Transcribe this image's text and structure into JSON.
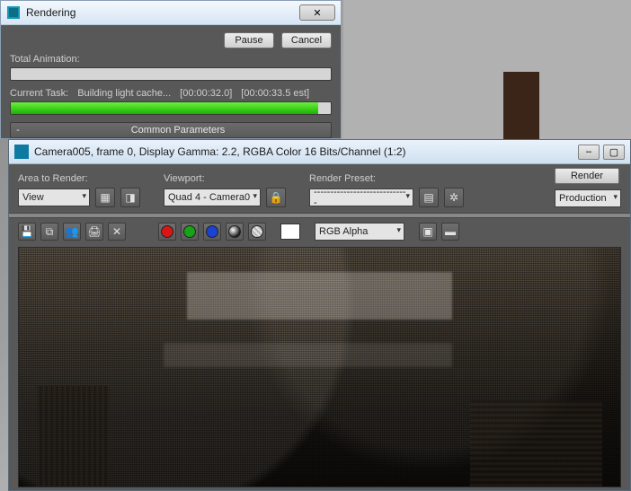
{
  "rendering_dialog": {
    "title": "Rendering",
    "close_glyph": "✕",
    "pause_label": "Pause",
    "cancel_label": "Cancel",
    "total_anim_label": "Total Animation:",
    "total_anim_pct": 0,
    "current_task_label": "Current Task:",
    "current_task_text": "Building light cache...",
    "elapsed": "[00:00:32.0]",
    "estimated": "[00:00:33.5 est]",
    "current_task_pct": 96,
    "params_dash": "-",
    "params_title": "Common Parameters"
  },
  "framebuffer": {
    "title": "Camera005, frame 0, Display Gamma: 2.2, RGBA Color 16 Bits/Channel (1:2)",
    "win_min": "–",
    "win_max": "▢",
    "area_label": "Area to Render:",
    "area_value": "View",
    "viewport_label": "Viewport:",
    "viewport_value": "Quad 4 - Camera0",
    "preset_label": "Render Preset:",
    "preset_value": "-----------------------------",
    "render_btn": "Render",
    "production_value": "Production",
    "channel_value": "RGB Alpha",
    "icons": {
      "region_selected": "region-selected-icon",
      "region_blowup": "region-blowup-icon",
      "lock": "lock-icon",
      "preset_load": "preset-load-icon",
      "preset_settings": "preset-settings-icon",
      "save": "save-icon",
      "copy": "copy-icon",
      "clone": "clone-icon",
      "print": "print-icon",
      "clear": "clear-icon",
      "toggle_ui": "toggle-overlay-icon",
      "toggle_frame": "toggle-frame-icon",
      "red": "red-channel",
      "green": "green-channel",
      "blue": "blue-channel",
      "mono": "mono-channel",
      "alpha": "alpha-channel"
    }
  }
}
